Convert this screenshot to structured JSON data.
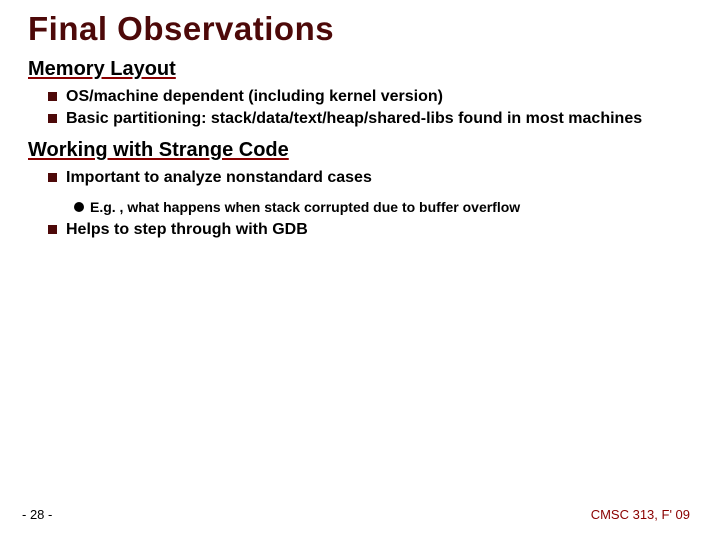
{
  "title": "Final Observations",
  "sections": [
    {
      "heading": "Memory Layout",
      "bullets": [
        {
          "text": "OS/machine dependent (including kernel version)",
          "sub": []
        },
        {
          "text": "Basic partitioning: stack/data/text/heap/shared-libs found in most machines",
          "sub": []
        }
      ]
    },
    {
      "heading": "Working with Strange Code",
      "bullets": [
        {
          "text": "Important to analyze nonstandard cases",
          "sub": [
            "E.g. , what happens when stack corrupted due to buffer overflow"
          ]
        },
        {
          "text": "Helps to step through with GDB",
          "sub": []
        }
      ]
    }
  ],
  "footer": {
    "page": "- 28 -",
    "course": "CMSC 313, F' 09"
  }
}
